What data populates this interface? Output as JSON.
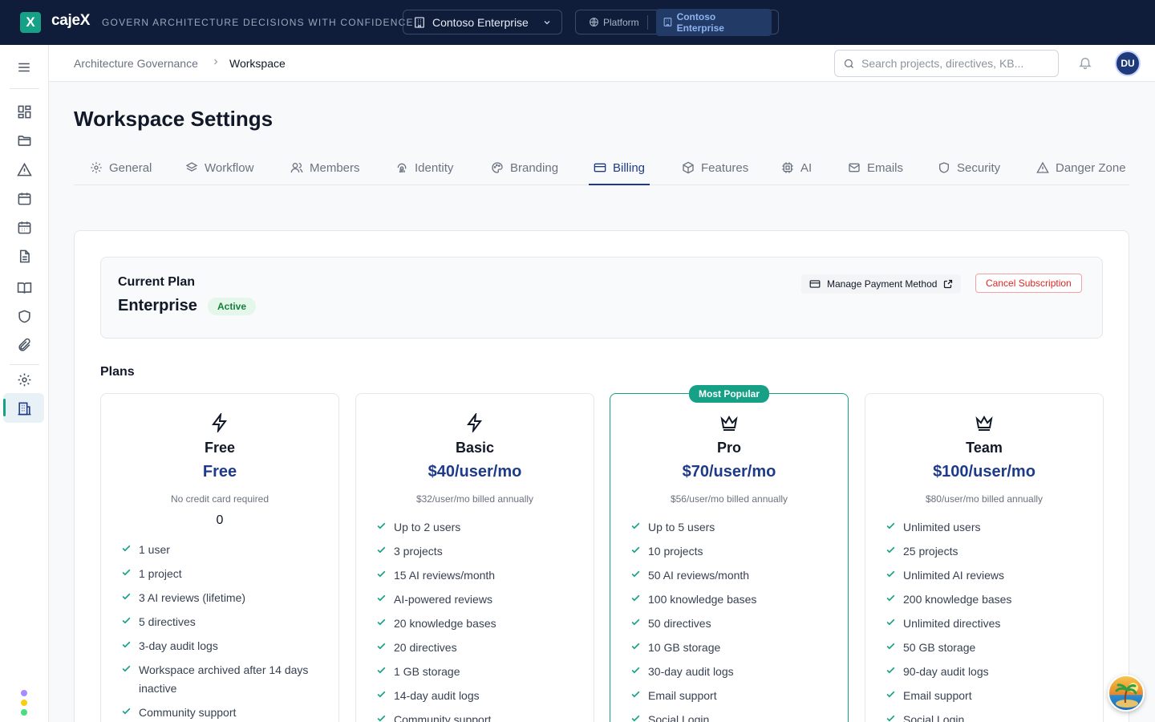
{
  "app": {
    "logo_letter": "X",
    "brand": "cajeX",
    "tagline": "GOVERN ARCHITECTURE DECISIONS WITH CONFIDENCE",
    "org_select": "Contoso Enterprise",
    "context": {
      "platform": "Platform",
      "org": "Contoso Enterprise"
    }
  },
  "breadcrumb": {
    "parent": "Architecture Governance",
    "current": "Workspace"
  },
  "search": {
    "placeholder": "Search projects, directives, KB..."
  },
  "user": {
    "initials": "DU"
  },
  "page": {
    "title": "Workspace Settings"
  },
  "tabs": [
    {
      "label": "General",
      "icon": "gear-icon"
    },
    {
      "label": "Workflow",
      "icon": "layers-icon"
    },
    {
      "label": "Members",
      "icon": "users-icon"
    },
    {
      "label": "Identity",
      "icon": "fingerprint-icon"
    },
    {
      "label": "Branding",
      "icon": "palette-icon"
    },
    {
      "label": "Billing",
      "icon": "credit-card-icon",
      "active": true
    },
    {
      "label": "Features",
      "icon": "box-icon"
    },
    {
      "label": "AI",
      "icon": "cpu-icon"
    },
    {
      "label": "Emails",
      "icon": "mail-icon"
    },
    {
      "label": "Security",
      "icon": "shield-icon"
    },
    {
      "label": "Danger Zone",
      "icon": "warning-icon"
    }
  ],
  "current_plan": {
    "label": "Current Plan",
    "name": "Enterprise",
    "status": "Active",
    "manage_payment": "Manage Payment Method",
    "cancel": "Cancel Subscription"
  },
  "plans_label": "Plans",
  "plans": [
    {
      "icon": "zap-icon",
      "name": "Free",
      "price": "Free",
      "note": "No credit card required",
      "extra": "0",
      "features": [
        "1 user",
        "1 project",
        "3 AI reviews (lifetime)",
        "5 directives",
        "3-day audit logs",
        "Workspace archived after 14 days inactive",
        "Community support"
      ]
    },
    {
      "icon": "zap-icon",
      "name": "Basic",
      "price": "$40/user/mo",
      "note": "$32/user/mo billed annually",
      "features": [
        "Up to 2 users",
        "3 projects",
        "15 AI reviews/month",
        "AI-powered reviews",
        "20 knowledge bases",
        "20 directives",
        "1 GB storage",
        "14-day audit logs",
        "Community support"
      ]
    },
    {
      "icon": "crown-icon",
      "name": "Pro",
      "badge": "Most Popular",
      "price": "$70/user/mo",
      "note": "$56/user/mo billed annually",
      "features": [
        "Up to 5 users",
        "10 projects",
        "50 AI reviews/month",
        "100 knowledge bases",
        "50 directives",
        "10 GB storage",
        "30-day audit logs",
        "Email support",
        "Social Login"
      ]
    },
    {
      "icon": "crown-icon",
      "name": "Team",
      "price": "$100/user/mo",
      "note": "$80/user/mo billed annually",
      "features": [
        "Unlimited users",
        "25 projects",
        "Unlimited AI reviews",
        "200 knowledge bases",
        "Unlimited directives",
        "50 GB storage",
        "90-day audit logs",
        "Email support",
        "Social Login"
      ]
    }
  ],
  "colors": {
    "accent": "#16a085",
    "primary": "#1e3a8a",
    "topbar": "#0f1d3a",
    "danger": "#dc2626"
  }
}
